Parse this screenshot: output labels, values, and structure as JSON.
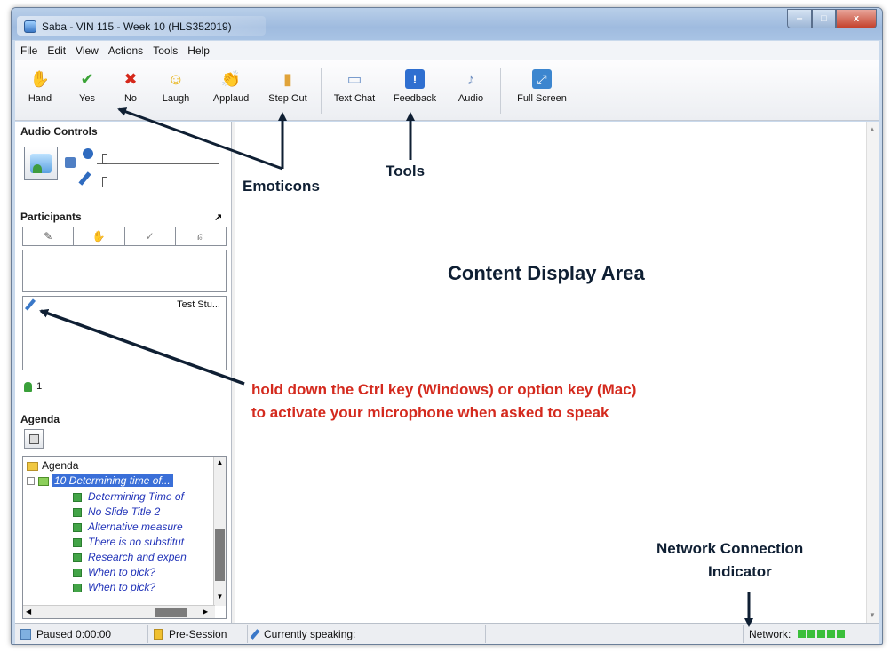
{
  "window": {
    "title": "Saba - VIN 115 - Week 10 (HLS352019)",
    "minimize_label": "‒",
    "maximize_label": "□",
    "close_label": "x"
  },
  "menu": [
    "File",
    "Edit",
    "View",
    "Actions",
    "Tools",
    "Help"
  ],
  "toolbar": {
    "buttons": [
      {
        "label": "Hand",
        "icon": "hand-icon",
        "glyph": "✋",
        "color": "#e08a2e"
      },
      {
        "label": "Yes",
        "icon": "checkmark-icon",
        "glyph": "✔",
        "color": "#3aa336"
      },
      {
        "label": "No",
        "icon": "x-icon",
        "glyph": "✖",
        "color": "#d5281b"
      },
      {
        "label": "Laugh",
        "icon": "laugh-icon",
        "glyph": "☺",
        "color": "#e8b418"
      },
      {
        "label": "Applaud",
        "icon": "applaud-icon",
        "glyph": "👏",
        "color": "#d9893a"
      },
      {
        "label": "Step Out",
        "icon": "step-out-icon",
        "glyph": "▮",
        "color": "#e0a33a"
      },
      {
        "label": "Text Chat",
        "icon": "text-chat-icon",
        "glyph": "▭",
        "color": "#7a9ccd"
      },
      {
        "label": "Feedback",
        "icon": "feedback-icon",
        "glyph": "!",
        "color": "#2f6fd0"
      },
      {
        "label": "Audio",
        "icon": "audio-icon",
        "glyph": "♪",
        "color": "#6f8fc0"
      },
      {
        "label": "Full Screen",
        "icon": "full-screen-icon",
        "glyph": "⤢",
        "color": "#3c86cf"
      }
    ]
  },
  "audio_controls": {
    "header": "Audio Controls"
  },
  "participants": {
    "header": "Participants",
    "participant_name": "Test Stu...",
    "count": "1"
  },
  "agenda": {
    "header": "Agenda",
    "root_label": "Agenda",
    "selected_item": "10 Determining time of...",
    "items": [
      "Determining Time of",
      "No Slide Title 2",
      "Alternative measure",
      "There is no substitut",
      "Research and expen",
      "When to pick?",
      "When to pick?"
    ]
  },
  "annotations": {
    "emoticons": "Emoticons",
    "tools": "Tools",
    "content_area": "Content Display Area",
    "mic_line1": "hold down the Ctrl key (Windows) or option key (Mac)",
    "mic_line2": "to activate your microphone when asked to speak",
    "network_line1": "Network Connection",
    "network_line2": "Indicator"
  },
  "status_bar": {
    "paused": "Paused 0:00:00",
    "session": "Pre-Session",
    "speaking": "Currently speaking:",
    "network_label": "Network:",
    "network_bars": 5
  },
  "colors": {
    "annotation_blue": "#0f1f33",
    "annotation_red": "#d42a1e",
    "network_green": "#3bbf3b",
    "agenda_text": "#2032b8"
  }
}
